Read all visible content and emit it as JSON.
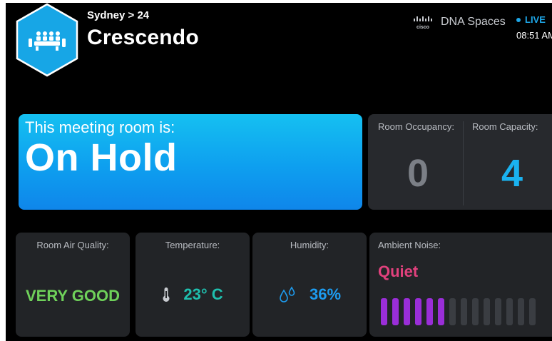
{
  "header": {
    "breadcrumb": "Sydney > 24",
    "room_name": "Crescendo",
    "brand_name": "DNA Spaces",
    "cisco_logo_text": "cisco",
    "live_label": "LIVE",
    "time": "08:51 AM"
  },
  "status": {
    "caption": "This meeting room is:",
    "value": "On Hold"
  },
  "occupancy": {
    "occupancy_label": "Room Occupancy:",
    "occupancy_value": "0",
    "capacity_label": "Room Capacity:",
    "capacity_value": "4"
  },
  "air_quality": {
    "label": "Room Air Quality:",
    "value": "VERY GOOD"
  },
  "temperature": {
    "label": "Temperature:",
    "value": "23° C"
  },
  "humidity": {
    "label": "Humidity:",
    "value": "36%"
  },
  "noise": {
    "label": "Ambient Noise:",
    "value": "Quiet",
    "level_active_bars": 6,
    "total_bars": 14
  },
  "colors": {
    "status_blue": "#0f9ff0",
    "occupancy_gray": "#7b7f86",
    "capacity_blue": "#1ab2f0",
    "air_quality_green": "#6fd15a",
    "temperature_teal": "#1fbfae",
    "humidity_blue": "#1d9cf0",
    "noise_pink": "#e2417d",
    "noise_bar_active": "#9a2ed8",
    "noise_bar_inactive": "#3a3d42",
    "live_blue": "#1ea7e8"
  },
  "icons": {
    "logo": "meeting-room-hexagon-icon",
    "temperature": "thermometer-icon",
    "humidity": "water-drops-icon",
    "live": "live-dot-icon"
  }
}
